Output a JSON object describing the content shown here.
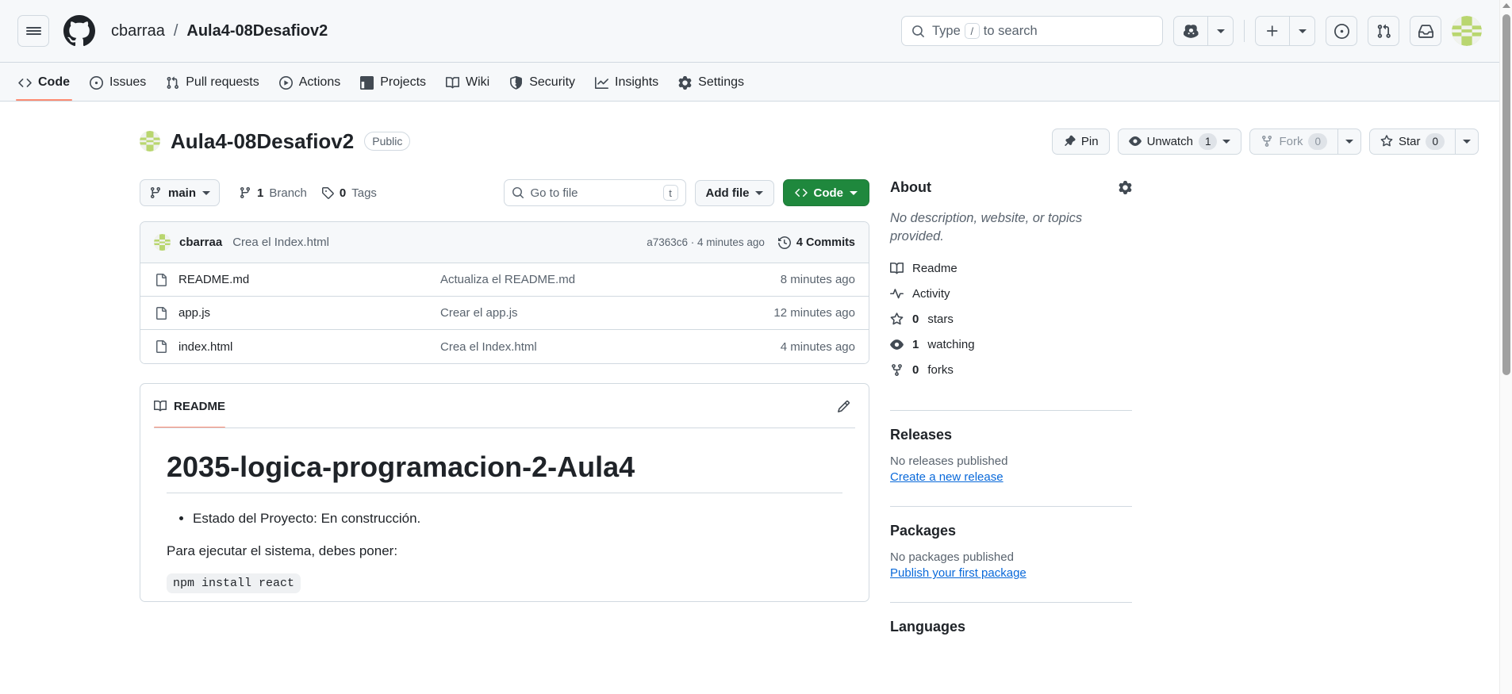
{
  "header": {
    "menu_icon": "hamburger-icon",
    "logo_icon": "github-mark-icon",
    "owner": "cbarraa",
    "separator": "/",
    "repo": "Aula4-08Desafiov2",
    "search": {
      "placeholder_prefix": "Type",
      "kbd": "/",
      "placeholder_suffix": "to search"
    },
    "copilot_icon": "copilot-icon",
    "create_new_icon": "plus-icon",
    "issues_icon": "issue-opened-icon",
    "pull_requests_icon": "git-pull-request-icon",
    "notifications_icon": "inbox-icon",
    "avatar_icon": "user-avatar"
  },
  "nav": {
    "tabs": [
      {
        "label": "Code",
        "icon": "code-icon",
        "active": true
      },
      {
        "label": "Issues",
        "icon": "issue-opened-icon",
        "active": false
      },
      {
        "label": "Pull requests",
        "icon": "git-pull-request-icon",
        "active": false
      },
      {
        "label": "Actions",
        "icon": "play-icon",
        "active": false
      },
      {
        "label": "Projects",
        "icon": "table-icon",
        "active": false
      },
      {
        "label": "Wiki",
        "icon": "book-icon",
        "active": false
      },
      {
        "label": "Security",
        "icon": "shield-icon",
        "active": false
      },
      {
        "label": "Insights",
        "icon": "graph-icon",
        "active": false
      },
      {
        "label": "Settings",
        "icon": "gear-icon",
        "active": false
      }
    ]
  },
  "repo": {
    "name": "Aula4-08Desafiov2",
    "visibility": "Public",
    "actions": {
      "pin": "Pin",
      "watch": "Unwatch",
      "watch_count": "1",
      "fork": "Fork",
      "fork_count": "0",
      "star": "Star",
      "star_count": "0"
    }
  },
  "toolbar": {
    "branch": "main",
    "branch_count": "1",
    "branch_label": "Branch",
    "tag_count": "0",
    "tag_label": "Tags",
    "go_to_file_placeholder": "Go to file",
    "go_to_file_kbd": "t",
    "add_file": "Add file",
    "code_button": "Code"
  },
  "commit_bar": {
    "author": "cbarraa",
    "message": "Crea el Index.html",
    "sha_and_time": "a7363c6 · 4 minutes ago",
    "commits_count": "4 Commits"
  },
  "files": [
    {
      "icon": "file-icon",
      "name": "README.md",
      "message": "Actualiza el README.md",
      "time": "8 minutes ago"
    },
    {
      "icon": "file-icon",
      "name": "app.js",
      "message": "Crear el app.js",
      "time": "12 minutes ago"
    },
    {
      "icon": "file-icon",
      "name": "index.html",
      "message": "Crea el Index.html",
      "time": "4 minutes ago"
    }
  ],
  "readme": {
    "tab_label": "README",
    "edit_icon": "pencil-icon",
    "title": "2035-logica-programacion-2-Aula4",
    "bullet": "Estado del Proyecto: En construcción.",
    "paragraph": "Para ejecutar el sistema, debes poner:",
    "code": "npm install react"
  },
  "sidebar": {
    "about_title": "About",
    "about_gear_icon": "gear-icon",
    "description": "No description, website, or topics provided.",
    "links": [
      {
        "icon": "book-icon",
        "label": "Readme"
      },
      {
        "icon": "pulse-icon",
        "label": "Activity"
      },
      {
        "icon": "star-icon",
        "label_bold": "0",
        "label": "stars"
      },
      {
        "icon": "eye-icon",
        "label_bold": "1",
        "label": "watching"
      },
      {
        "icon": "fork-icon",
        "label_bold": "0",
        "label": "forks"
      }
    ],
    "releases": {
      "title": "Releases",
      "empty": "No releases published",
      "link": "Create a new release"
    },
    "packages": {
      "title": "Packages",
      "empty": "No packages published",
      "link": "Publish your first package"
    },
    "languages": {
      "title": "Languages"
    }
  },
  "colors": {
    "accent_green": "#1f883d",
    "link_blue": "#0969da",
    "active_underline": "#fd8c73",
    "border": "#d1d9e0",
    "canvas_subtle": "#f6f8fa",
    "muted_text": "#59636e"
  }
}
